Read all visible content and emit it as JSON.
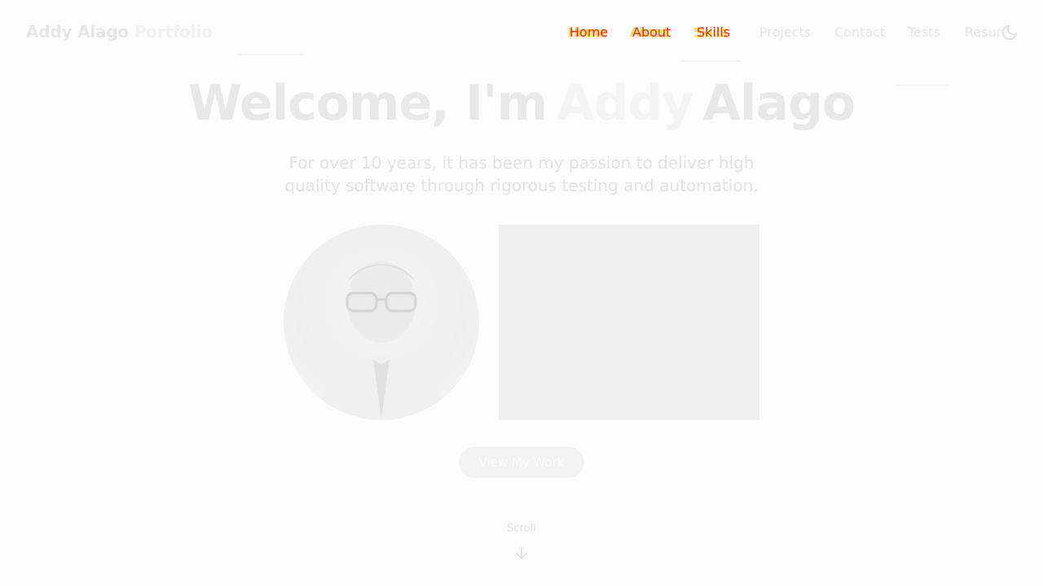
{
  "header": {
    "brand_name": "Addy Alago",
    "brand_accent": "Portfolio"
  },
  "nav": {
    "items": [
      {
        "label": "Home"
      },
      {
        "label": "About"
      },
      {
        "label": "Skills"
      },
      {
        "label": "Projects"
      },
      {
        "label": "Contact"
      },
      {
        "label": "Tests"
      },
      {
        "label": "Resume"
      }
    ],
    "theme_toggle_icon": "moon-icon"
  },
  "hero": {
    "title_prefix": "Welcome, I'm",
    "title_first": "Addy",
    "title_last": "Alago",
    "subtitle": "For over 10 years, it has been my passion to deliver high quality software through rigorous testing and automation.",
    "cta_label": "View My Work"
  },
  "scroll": {
    "label": "Scroll",
    "icon": "arrow-down-icon"
  },
  "colors": {
    "background": "#fdfdfd",
    "text_faded": "#e6e6e6",
    "glitch_red": "#ff1a00",
    "glitch_yellow": "#ffd400"
  }
}
